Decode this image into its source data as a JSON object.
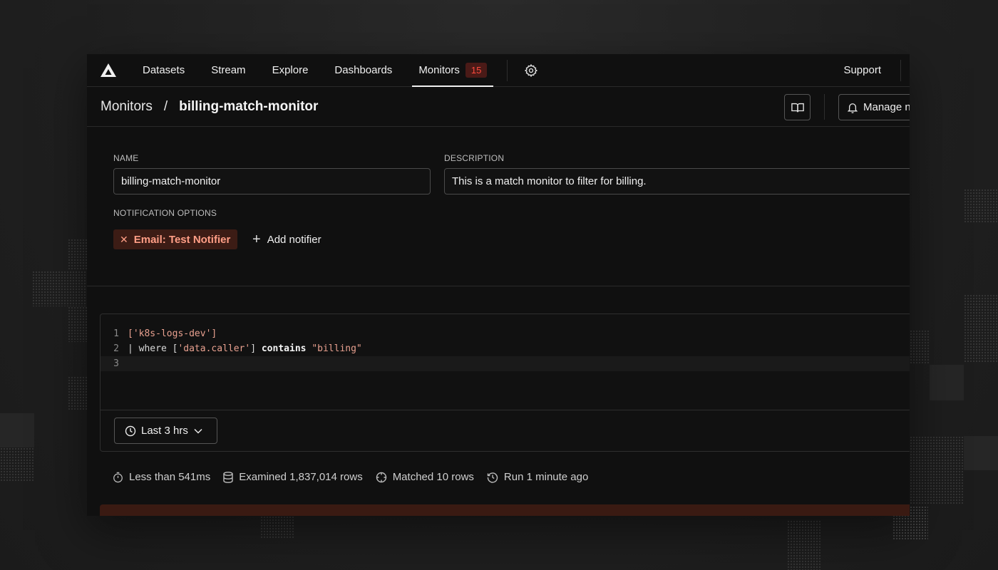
{
  "nav": {
    "items": [
      {
        "label": "Datasets"
      },
      {
        "label": "Stream"
      },
      {
        "label": "Explore"
      },
      {
        "label": "Dashboards"
      },
      {
        "label": "Monitors",
        "badge": "15",
        "active": true
      }
    ],
    "support_label": "Support"
  },
  "breadcrumb": {
    "parent": "Monitors",
    "separator": "/",
    "current": "billing-match-monitor",
    "manage_label": "Manage n"
  },
  "form": {
    "name_label": "NAME",
    "name_value": "billing-match-monitor",
    "description_label": "DESCRIPTION",
    "description_value": "This is a match monitor to filter for billing.",
    "notification_label": "NOTIFICATION OPTIONS",
    "notifier_chip": "Email: Test Notifier",
    "add_notifier_label": "Add notifier"
  },
  "editor": {
    "line_numbers": [
      "1",
      "2",
      "3"
    ],
    "line1_str": "['k8s-logs-dev']",
    "line2_a": "| where [",
    "line2_str": "'data.caller'",
    "line2_b": "] ",
    "line2_kw": "contains",
    "line2_c": " ",
    "line2_str2": "\"billing\""
  },
  "time_range": {
    "label": "Last 3 hrs"
  },
  "stats": {
    "duration": "Less than 541ms",
    "examined": "Examined 1,837,014 rows",
    "matched": "Matched 10 rows",
    "run": "Run 1 minute ago"
  },
  "colors": {
    "badge_bg": "#4a1a17",
    "badge_text": "#ff4a3d",
    "chip_bg": "#3c1c15",
    "chip_text": "#ff9e86",
    "string": "#e8a08f",
    "alert_bg": "#3a1a12"
  },
  "icons": {
    "logo": "axiom-logo-icon",
    "settings": "gear-icon",
    "book": "book-icon",
    "bell": "bell-icon",
    "remove": "close-icon",
    "add": "plus-icon",
    "clock": "clock-icon",
    "chevron": "chevron-down-icon",
    "timer": "stopwatch-icon",
    "database": "database-icon",
    "target": "crosshair-icon",
    "history": "history-icon"
  }
}
